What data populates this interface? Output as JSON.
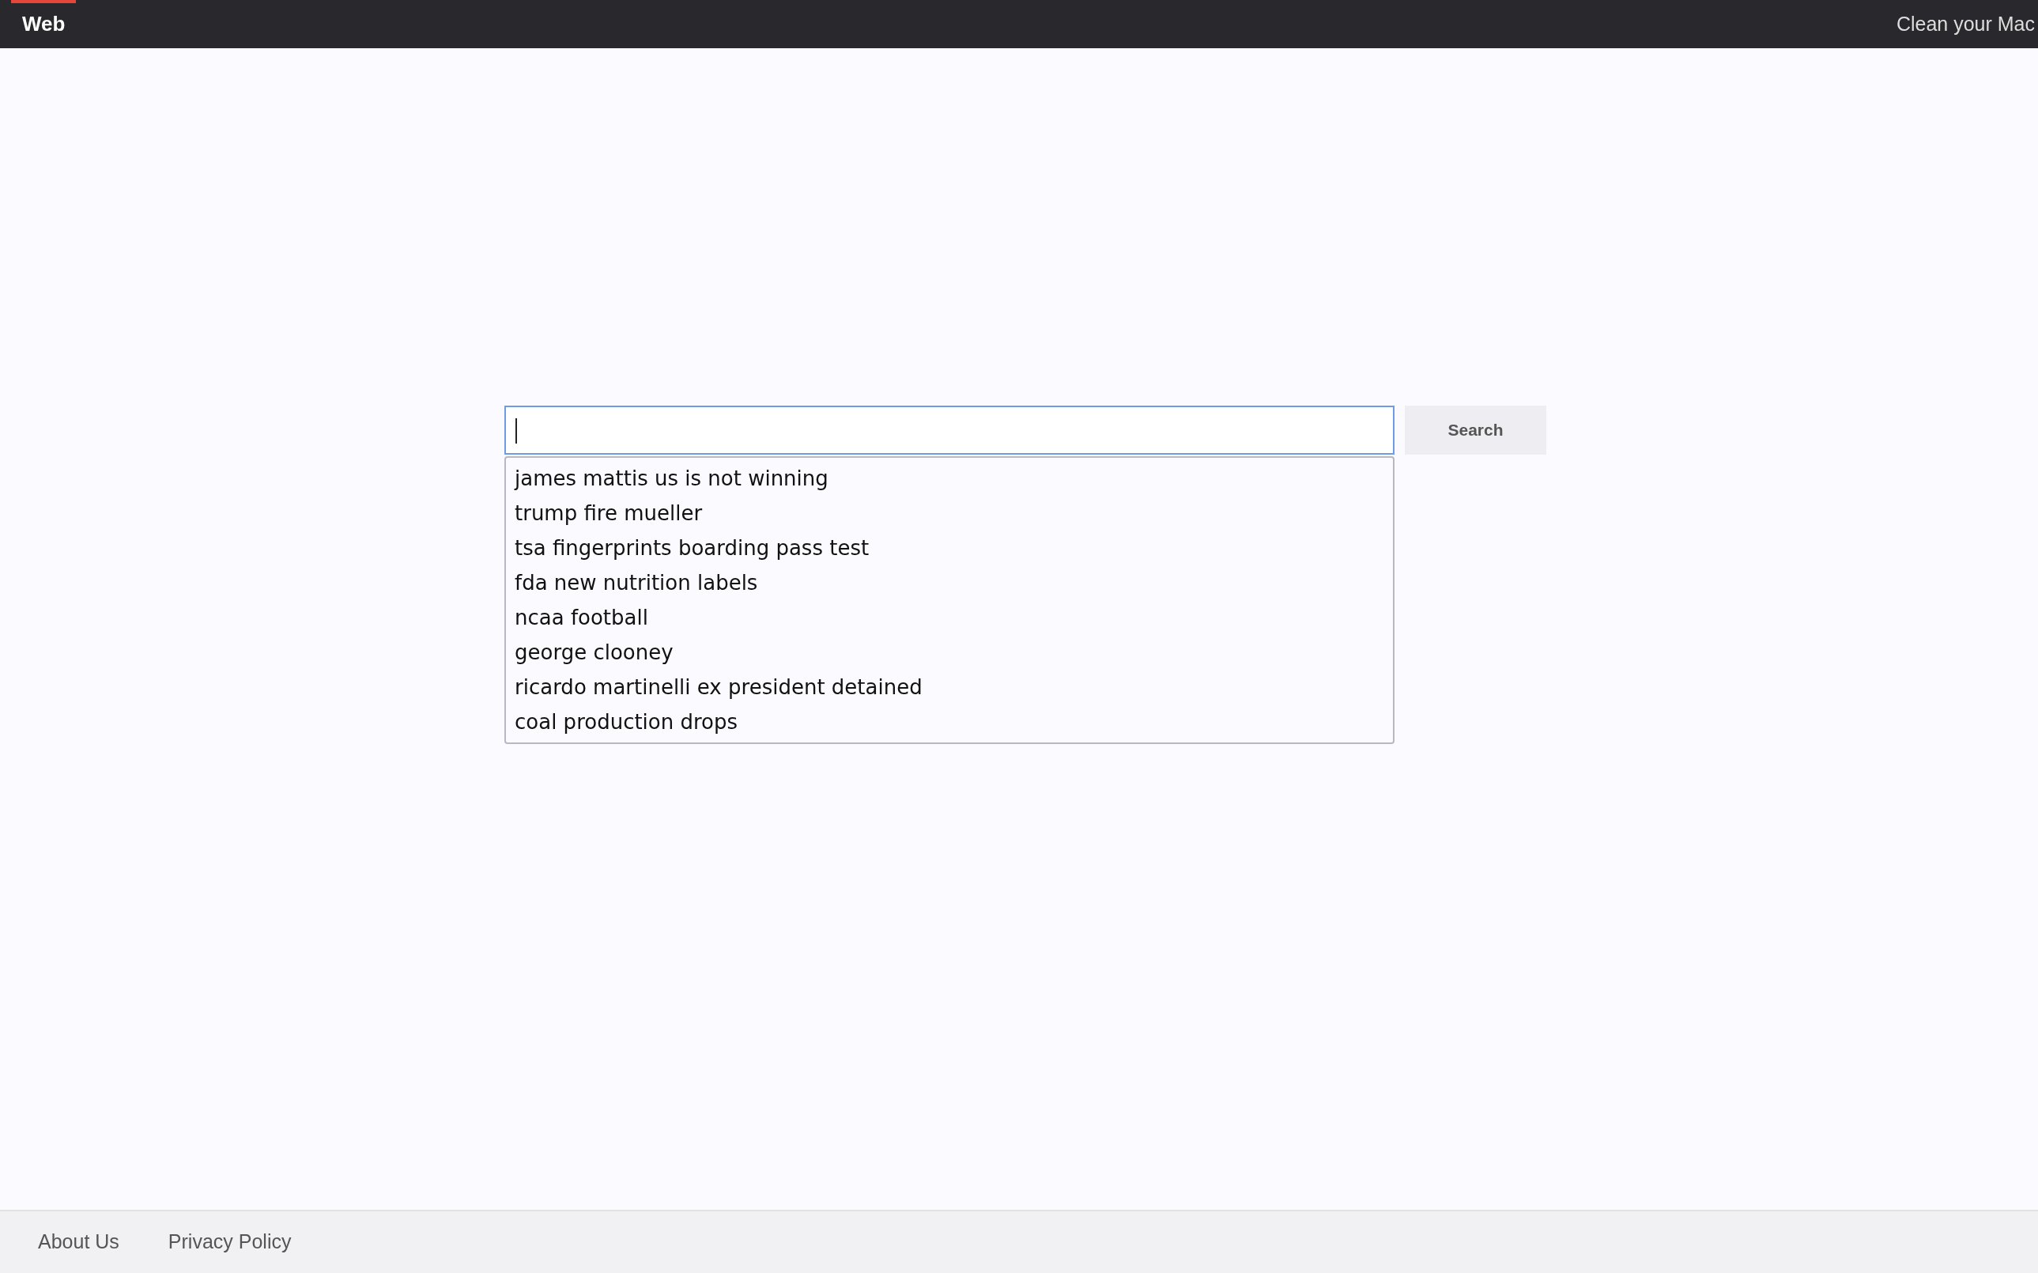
{
  "header": {
    "brand": "Web",
    "link": "Clean your Mac"
  },
  "search": {
    "button": "Search",
    "suggestions": [
      "james mattis us is not winning",
      "trump fire mueller",
      "tsa fingerprints boarding pass test",
      "fda new nutrition labels",
      "ncaa football",
      "george clooney",
      "ricardo martinelli ex president detained",
      "coal production drops"
    ]
  },
  "footer": {
    "links": [
      "About Us",
      "Privacy Policy"
    ]
  }
}
